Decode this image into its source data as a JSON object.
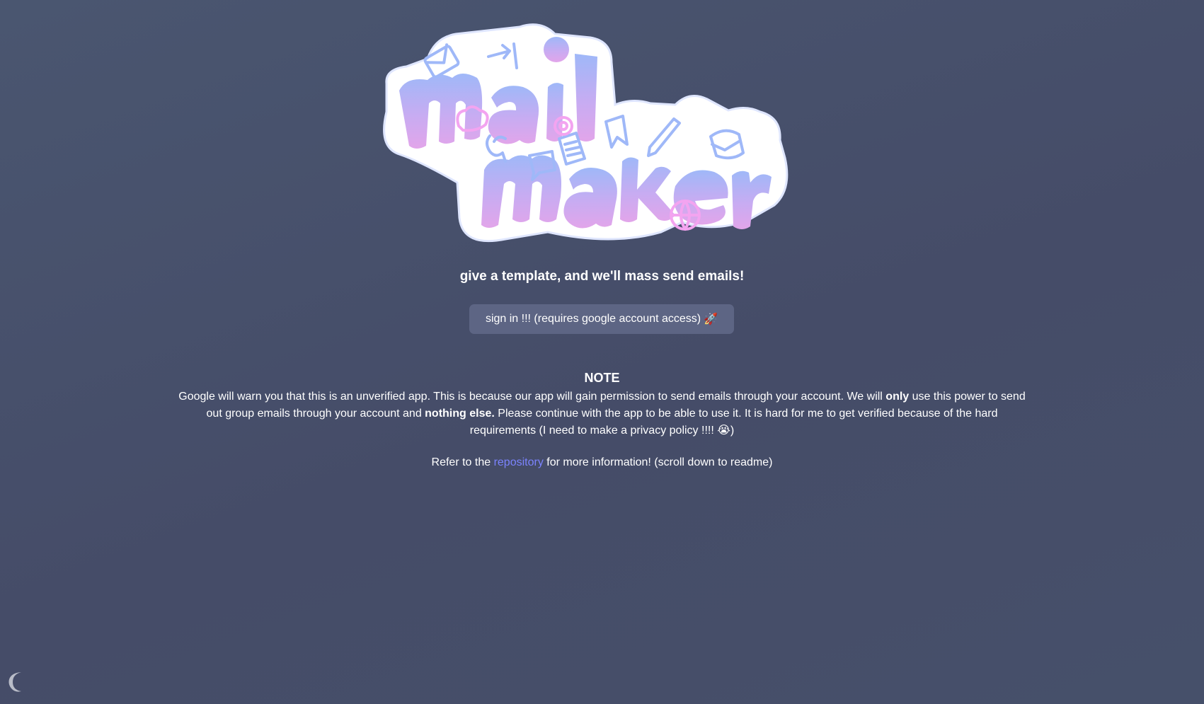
{
  "logo": {
    "line1": "mail",
    "line2": "maker"
  },
  "tagline": "give a template, and we'll mass send emails!",
  "signin_button": {
    "label": "sign in !!! (requires google account access)",
    "emoji": "🚀"
  },
  "note": {
    "title": "NOTE",
    "part1": "Google will warn you that this is an unverified app. This is because our app will gain permission to send emails through your account. We will ",
    "bold1": "only",
    "part2": " use this power to send out group emails through your account and ",
    "bold2": "nothing else.",
    "part3": " Please continue with the app to be able to use it. It is hard for me to get verified because of the hard requirements (I need to make a privacy policy !!!! ",
    "emoji": "😭",
    "part4": ")"
  },
  "refer": {
    "prefix": "Refer to the ",
    "link_label": "repository",
    "suffix": " for more information! (scroll down to readme)"
  },
  "colors": {
    "background": "#4a5470",
    "button": "#5d6584",
    "link": "#7b83ff",
    "logo_blue": "#9db4f7",
    "logo_pink": "#e4a6ec",
    "logo_outline": "#ffffff"
  },
  "icons": {
    "theme_toggle": "moon-icon"
  }
}
